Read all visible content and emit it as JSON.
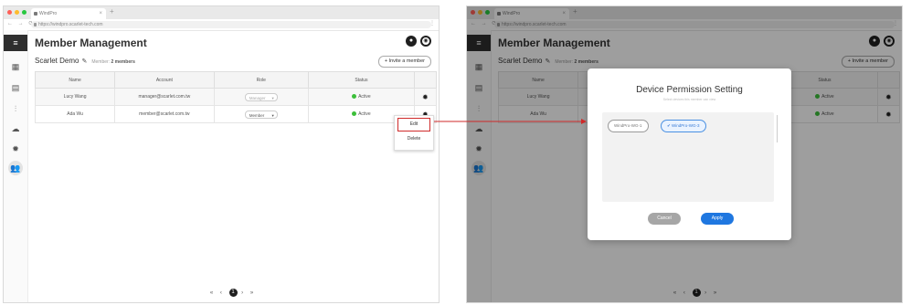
{
  "browser": {
    "tab_title": "WindPro",
    "url": "https://windpro.scarlet-tech.com",
    "new_tab": "+",
    "tab_close": "×",
    "nav_buttons": "← → ⟳",
    "menu": "⋮"
  },
  "page": {
    "title": "Member Management",
    "org_name": "Scarlet Demo",
    "edit_glyph": "✎",
    "member_label": "Member:",
    "member_count": "2 members",
    "invite_button": "+ Invite a member",
    "avatar_letter": "S"
  },
  "sidebar_icons": [
    "menu-icon",
    "grid-icon",
    "dashboard-icon",
    "chart-icon",
    "cloud-icon",
    "settings-icon",
    "members-icon"
  ],
  "table": {
    "headers": [
      "Name",
      "Account",
      "Role",
      "Status",
      ""
    ],
    "rows": [
      {
        "name": "Lucy Wang",
        "account": "manager@scarlet.com.tw",
        "role": "Manager",
        "status": "Active"
      },
      {
        "name": "Ada Wu",
        "account": "member@scarlet.com.tw",
        "role": "Member",
        "status": "Active"
      }
    ]
  },
  "context_menu": {
    "edit": "Edit",
    "delete": "Delete"
  },
  "pagination": {
    "first": "«",
    "prev": "‹",
    "current": "1",
    "next": "›",
    "last": "»"
  },
  "modal": {
    "title": "Device Permission Setting",
    "subtitle": "Select devices this member can view",
    "devices": [
      {
        "label": "WindPro-WG-1",
        "selected": false
      },
      {
        "label": "✔ WindPro-WG-3",
        "selected": true
      }
    ],
    "cancel": "Cancel",
    "apply": "Apply"
  },
  "colors": {
    "accent": "#1f77e0",
    "active": "#3cbf3a",
    "highlight": "#cf2a2a"
  }
}
